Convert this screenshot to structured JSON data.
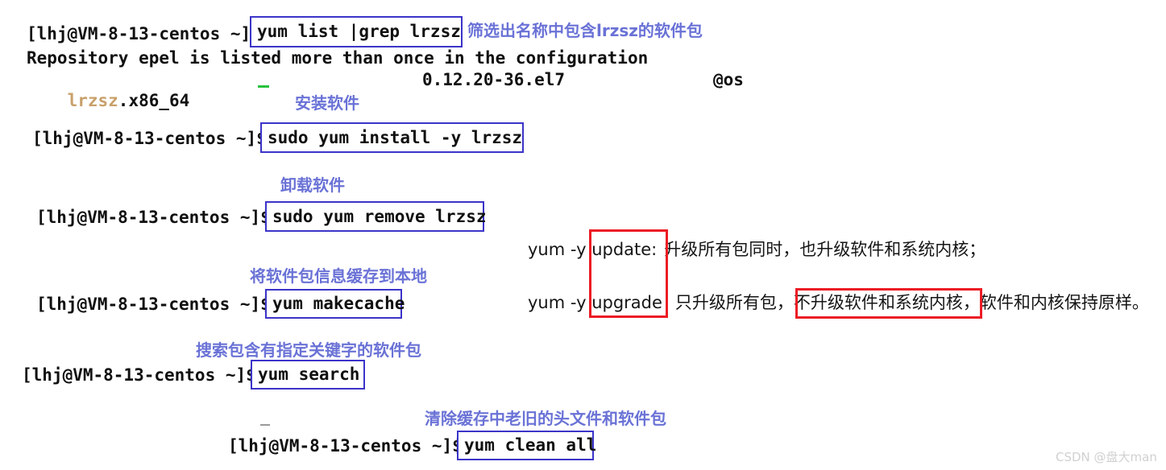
{
  "terminal": {
    "prompt": "[lhj@VM-8-13-centos ~]$",
    "lines": {
      "repo_warning": "Repository epel is listed more than once in the configuration",
      "pkg_name": "lrzsz",
      "pkg_arch": ".x86_64",
      "pkg_version": "0.12.20-36.el7",
      "pkg_repo": "@os"
    }
  },
  "commands": [
    {
      "id": "yum-list-grep",
      "text": "yum list |grep lrzsz",
      "note": "筛选出名称中包含lrzsz的软件包"
    },
    {
      "id": "yum-install",
      "text": "sudo yum install -y lrzsz",
      "note": "安装软件"
    },
    {
      "id": "yum-remove",
      "text": "sudo yum remove lrzsz",
      "note": "卸载软件"
    },
    {
      "id": "yum-makecache",
      "text": "yum makecache",
      "note": "将软件包信息缓存到本地"
    },
    {
      "id": "yum-search",
      "text": "yum search",
      "note": "搜索包含有指定关键字的软件包"
    },
    {
      "id": "yum-clean-all",
      "text": "yum clean all",
      "note": "清除缓存中老旧的头文件和软件包"
    }
  ],
  "explanations": [
    {
      "id": "yum-update",
      "prefix": "yum -y ",
      "keyword": "update:",
      "description": "升级所有包同时，也升级软件和系统内核；"
    },
    {
      "id": "yum-upgrade",
      "prefix": "yum -y ",
      "keyword": "upgrade",
      "desc_part1": "只升级所有包，",
      "highlight": "不升级软件和系统内核，",
      "desc_part2": "软件和内核保持原样。"
    }
  ],
  "colors": {
    "command_box_border": "#3b34c8",
    "note_text": "#6a72d6",
    "highlight_box": "#ec1c24",
    "package_name": "#c8a06a",
    "terminal_text": "#101010"
  },
  "watermark": {
    "text": "CSDN @盘大man"
  }
}
